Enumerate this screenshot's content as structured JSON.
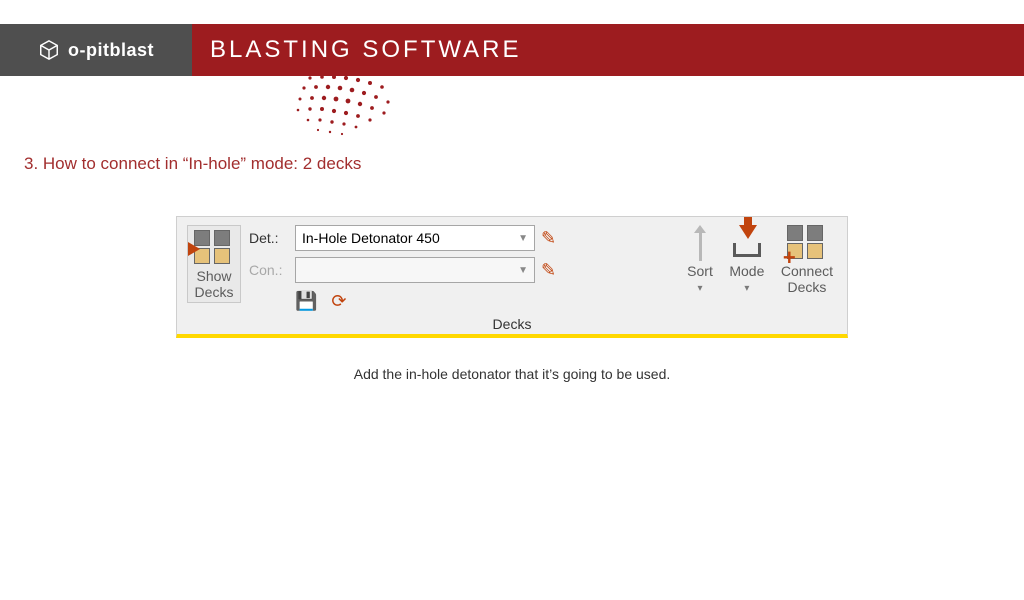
{
  "header": {
    "brand": "o-pitblast",
    "title": "BLASTING SOFTWARE"
  },
  "heading": "3. How to connect in “In-hole” mode: 2 decks",
  "ribbon": {
    "panel_name": "Decks",
    "show_decks": "Show\nDecks",
    "det_label": "Det.:",
    "con_label": "Con.:",
    "det_value": "In-Hole Detonator 450",
    "con_value": "",
    "sort": "Sort",
    "mode": "Mode",
    "connect_decks": "Connect\nDecks"
  },
  "caption": "Add the in-hole detonator that it’s going to be used."
}
